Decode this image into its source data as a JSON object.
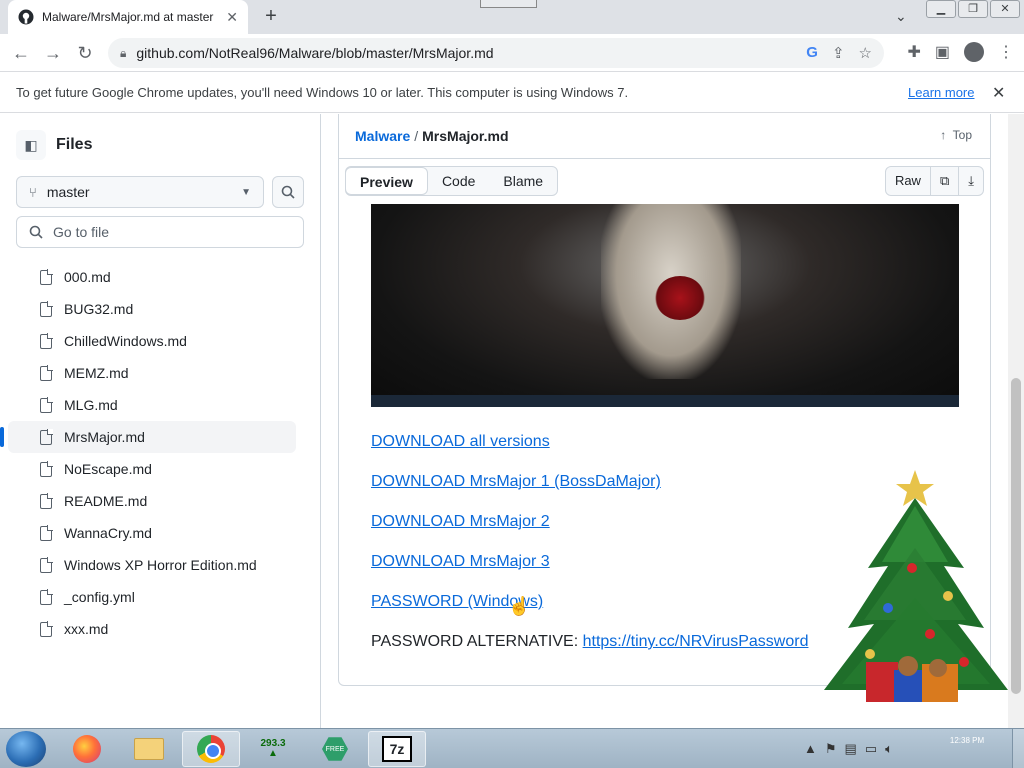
{
  "browser": {
    "tab_title": "Malware/MrsMajor.md at master",
    "url": "github.com/NotReal96/Malware/blob/master/MrsMajor.md",
    "infobar_text": "To get future Google Chrome updates, you'll need Windows 10 or later. This computer is using Windows 7.",
    "infobar_link": "Learn more"
  },
  "sidebar": {
    "title": "Files",
    "branch": "master",
    "goto_placeholder": "Go to file",
    "files": [
      {
        "name": "000.md"
      },
      {
        "name": "BUG32.md"
      },
      {
        "name": "ChilledWindows.md"
      },
      {
        "name": "MEMZ.md"
      },
      {
        "name": "MLG.md"
      },
      {
        "name": "MrsMajor.md",
        "active": true
      },
      {
        "name": "NoEscape.md"
      },
      {
        "name": "README.md"
      },
      {
        "name": "WannaCry.md"
      },
      {
        "name": "Windows XP Horror Edition.md"
      },
      {
        "name": "_config.yml"
      },
      {
        "name": "xxx.md"
      }
    ]
  },
  "header": {
    "repo": "Malware",
    "separator": "/",
    "file": "MrsMajor.md",
    "top_label": "Top",
    "tabs": [
      "Preview",
      "Code",
      "Blame"
    ],
    "active_tab": "Preview",
    "raw_label": "Raw"
  },
  "content": {
    "links": [
      "DOWNLOAD all versions",
      "DOWNLOAD MrsMajor 1 (BossDaMajor)",
      "DOWNLOAD MrsMajor 2",
      "DOWNLOAD MrsMajor 3",
      "PASSWORD (Windows)"
    ],
    "pw_alt_label": "PASSWORD ALTERNATIVE:",
    "pw_alt_link": "https://tiny.cc/NRVirusPassword"
  },
  "taskbar": {
    "tree_counter": "293.3",
    "sevenz_label": "7z",
    "clock_line1": "12:38 PM",
    "clock_line2": ""
  },
  "colors": {
    "accent": "#0969da",
    "active_marker": "#0969da"
  }
}
